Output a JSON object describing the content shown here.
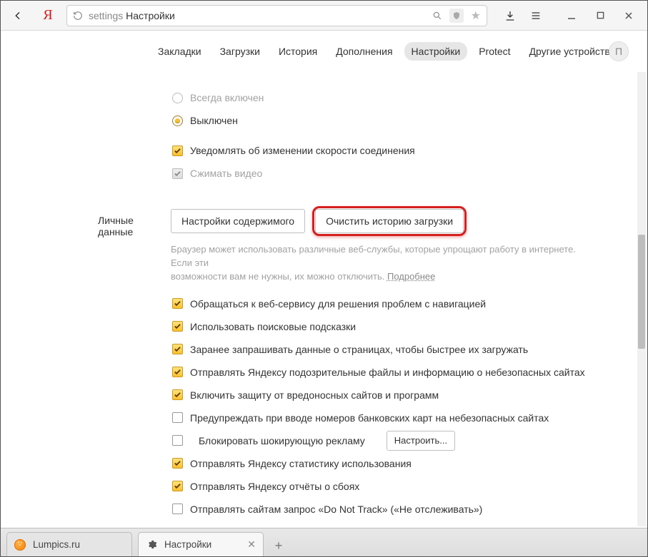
{
  "address": {
    "path_preface": "settings",
    "title": "Настройки"
  },
  "nav": {
    "items": [
      "Закладки",
      "Загрузки",
      "История",
      "Дополнения",
      "Настройки",
      "Protect",
      "Другие устройства"
    ],
    "active_index": 4,
    "avatar_letter": "П"
  },
  "turbo": {
    "radios": {
      "always_on": "Всегда включен",
      "off": "Выключен"
    },
    "notify_speed": "Уведомлять об изменении скорости соединения",
    "compress_video": "Сжимать видео"
  },
  "privacy": {
    "section_label": "Личные данные",
    "content_settings_btn": "Настройки содержимого",
    "clear_history_btn": "Очистить историю загрузки",
    "help_line1": "Браузер может использовать различные веб-службы, которые упрощают работу в интернете. Если эти",
    "help_line2_a": "возможности вам не нужны, их можно отключить. ",
    "help_more": "Подробнее",
    "opts": {
      "nav_problems": "Обращаться к веб-сервису для решения проблем с навигацией",
      "search_suggest": "Использовать поисковые подсказки",
      "prefetch": "Заранее запрашивать данные о страницах, чтобы быстрее их загружать",
      "send_suspicious": "Отправлять Яндексу подозрительные файлы и информацию о небезопасных сайтах",
      "malware_protect": "Включить защиту от вредоносных сайтов и программ",
      "warn_cards": "Предупреждать при вводе номеров банковских карт на небезопасных сайтах",
      "block_shock": "Блокировать шокирующую рекламу",
      "configure_btn": "Настроить...",
      "usage_stats": "Отправлять Яндексу статистику использования",
      "crash_reports": "Отправлять Яндексу отчёты о сбоях",
      "dnt": "Отправлять сайтам запрос «Do Not Track» («Не отслеживать»)"
    }
  },
  "tabs": {
    "t1": "Lumpics.ru",
    "t2": "Настройки"
  }
}
